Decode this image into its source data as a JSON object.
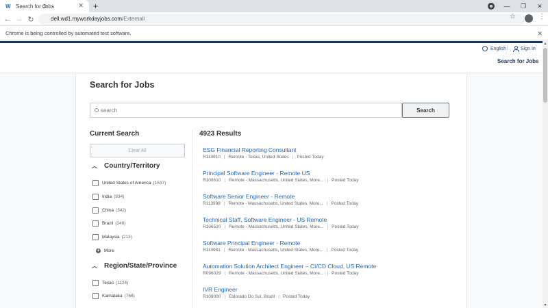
{
  "browser": {
    "tab_title": "Search for Jobs",
    "new_tab": "+",
    "url_host": "dell.wd1.myworkdayjobs.com",
    "url_path": "/External/",
    "infobar_text": "Chrome is being controlled by automated test software."
  },
  "header": {
    "language": "English",
    "sign_in": "Sign In",
    "search_jobs_link": "Search for Jobs"
  },
  "page": {
    "title": "Search for Jobs",
    "search_placeholder": "search",
    "search_button": "Search"
  },
  "filters": {
    "current_search": "Current Search",
    "clear_all": "Clear All",
    "country": {
      "heading": "Country/Territory",
      "options": [
        {
          "label": "United States of America",
          "count": "(1537)"
        },
        {
          "label": "India",
          "count": "(934)"
        },
        {
          "label": "China",
          "count": "(342)"
        },
        {
          "label": "Brazil",
          "count": "(246)"
        },
        {
          "label": "Malaysia",
          "count": "(213)"
        }
      ],
      "more": "More"
    },
    "region": {
      "heading": "Region/State/Province",
      "options": [
        {
          "label": "Texas",
          "count": "(1124)"
        },
        {
          "label": "Karnataka",
          "count": "(766)"
        }
      ]
    }
  },
  "results": {
    "count": "4923 Results",
    "jobs": [
      {
        "title": "ESG Financial Reporting Consultant",
        "id": "R113910",
        "location": "Remote - Texas, United States",
        "posted": "Posted Today"
      },
      {
        "title": "Principal Software Engineer - Remote US",
        "id": "R108610",
        "location": "Remote - Massachusetts, United States, More...",
        "posted": "Posted Today"
      },
      {
        "title": "Software Senior Engineer - Remote",
        "id": "R113998",
        "location": "Remote - Massachusetts, United States, More...",
        "posted": "Posted Today"
      },
      {
        "title": "Technical Staff, Software Engineer - US Remote",
        "id": "R106510",
        "location": "Remote - Massachusetts, United States, More...",
        "posted": "Posted Today"
      },
      {
        "title": "Software Principal Engineer - Remote",
        "id": "R113981",
        "location": "Remote - Massachusetts, United States, More...",
        "posted": "Posted Today"
      },
      {
        "title": "Automation Solution Architect Engineer – CI/CD Cloud, US Remote",
        "id": "R096029",
        "location": "Remote - Massachusetts, United States, More...",
        "posted": "Posted Today"
      },
      {
        "title": "IVR Engineer",
        "id": "R108000",
        "location": "Eldorado Do Sul, Brazil",
        "posted": "Posted Today"
      }
    ]
  }
}
